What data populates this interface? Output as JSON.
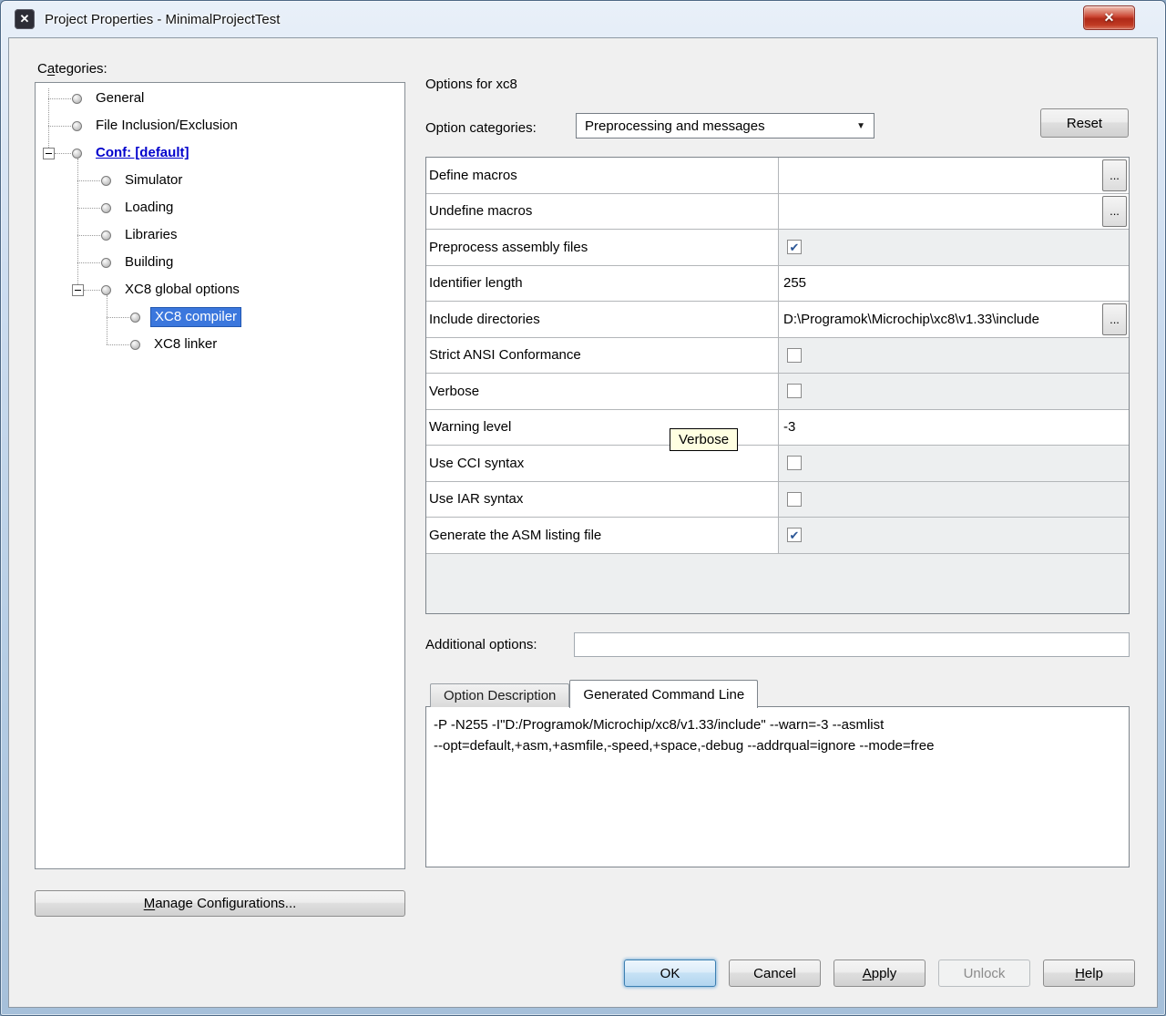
{
  "colors": {
    "selection": "#3b77dd",
    "link": "#0101cc",
    "tooltip": "#ffffe1",
    "close_button": "#c03a23"
  },
  "icons": {
    "app_x": "✕",
    "close": "✕",
    "check": "✔",
    "browse": "...",
    "dropdown_arrow": "▼"
  },
  "window": {
    "title": "Project Properties - MinimalProjectTest"
  },
  "left": {
    "categories_label": "Categories:",
    "tree": [
      {
        "label": "General",
        "level": 1
      },
      {
        "label": "File Inclusion/Exclusion",
        "level": 1
      },
      {
        "label": "Conf: [default]",
        "level": 1,
        "expander": true,
        "link": true
      },
      {
        "label": "Simulator",
        "level": 2
      },
      {
        "label": "Loading",
        "level": 2
      },
      {
        "label": "Libraries",
        "level": 2
      },
      {
        "label": "Building",
        "level": 2
      },
      {
        "label": "XC8 global options",
        "level": 2,
        "expander": true
      },
      {
        "label": "XC8 compiler",
        "level": 3,
        "selected": true
      },
      {
        "label": "XC8 linker",
        "level": 3
      }
    ],
    "manage_button": "Manage Configurations..."
  },
  "right": {
    "heading": "Options for xc8",
    "option_categories_label": "Option categories:",
    "option_categories_value": "Preprocessing and messages",
    "reset_button": "Reset",
    "rows": [
      {
        "label": "Define macros",
        "control": "text-browse",
        "value": ""
      },
      {
        "label": "Undefine macros",
        "control": "text-browse",
        "value": ""
      },
      {
        "label": "Preprocess assembly files",
        "control": "checkbox",
        "checked": true
      },
      {
        "label": "Identifier length",
        "control": "text",
        "value": "255"
      },
      {
        "label": "Include directories",
        "control": "text-browse",
        "value": "D:\\Programok\\Microchip\\xc8\\v1.33\\include"
      },
      {
        "label": "Strict ANSI Conformance",
        "control": "checkbox",
        "checked": false
      },
      {
        "label": "Verbose",
        "control": "checkbox",
        "checked": false
      },
      {
        "label": "Warning level",
        "control": "text",
        "value": "-3"
      },
      {
        "label": "Use CCI syntax",
        "control": "checkbox",
        "checked": false
      },
      {
        "label": "Use IAR syntax",
        "control": "checkbox",
        "checked": false
      },
      {
        "label": "Generate the ASM listing file",
        "control": "checkbox",
        "checked": true
      }
    ],
    "tooltip": "Verbose",
    "additional_options_label": "Additional options:",
    "additional_options_value": "",
    "tabs": [
      {
        "label": "Option Description",
        "active": false
      },
      {
        "label": "Generated Command Line",
        "active": true
      }
    ],
    "command_lines": [
      "-P -N255 -I\"D:/Programok/Microchip/xc8/v1.33/include\" --warn=-3 --asmlist",
      "--opt=default,+asm,+asmfile,-speed,+space,-debug --addrqual=ignore --mode=free"
    ]
  },
  "footer": {
    "buttons": [
      {
        "label": "OK",
        "default": true
      },
      {
        "label": "Cancel"
      },
      {
        "label": "Apply",
        "mnemonic": 0
      },
      {
        "label": "Unlock",
        "disabled": true
      },
      {
        "label": "Help",
        "mnemonic": 0
      }
    ]
  }
}
